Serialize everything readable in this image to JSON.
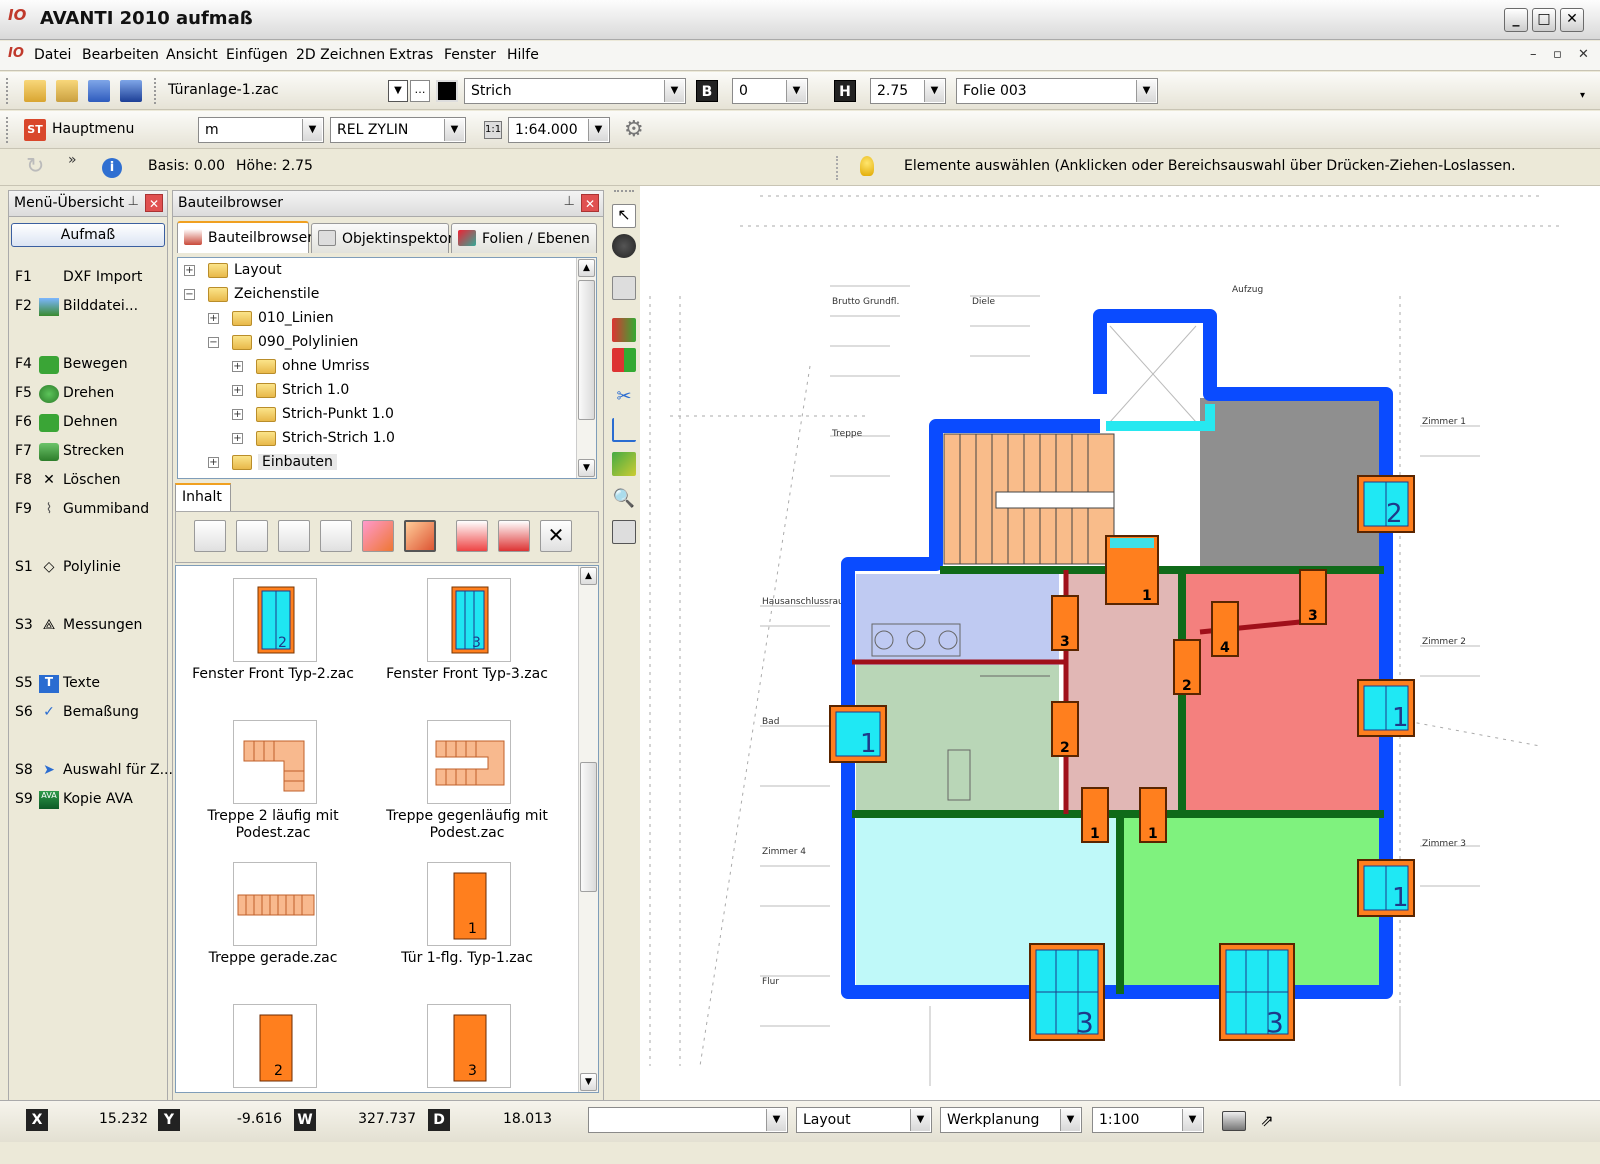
{
  "app": {
    "logo": "IO",
    "title": "AVANTI 2010 aufmaß",
    "window_buttons": [
      "_",
      "□",
      "✕"
    ],
    "mdi_buttons": [
      "–",
      "▫",
      "✕"
    ]
  },
  "menu": [
    "Datei",
    "Bearbeiten",
    "Ansicht",
    "Einfügen",
    "2D Zeichnen",
    "Extras",
    "Fenster",
    "Hilfe"
  ],
  "toolbar1": {
    "file_combo": "Türanlage-1.zac",
    "line_combo": "Strich",
    "b_label": "B",
    "b_value": "0",
    "h_label": "H",
    "h_value": "2.75",
    "layer_combo": "Folie 003"
  },
  "toolbar2": {
    "st_label": "ST",
    "mainmenu": "Hauptmenu",
    "unit": "m",
    "mode": "REL ZYLIN",
    "scale": "1:64.000"
  },
  "statusline": {
    "basis": "Basis: 0.00",
    "hoehe": "Höhe: 2.75",
    "hint": "Elemente auswählen (Anklicken oder Bereichsauswahl über Drücken-Ziehen-Loslassen."
  },
  "left_panel": {
    "title": "Menü-Übersicht",
    "button": "Aufmaß",
    "items": [
      {
        "key": "F1",
        "label": "DXF Import",
        "icon": "none"
      },
      {
        "key": "F2",
        "label": "Bilddatei...",
        "icon": "image-icon"
      },
      {
        "key": "F4",
        "label": "Bewegen",
        "icon": "move-icon"
      },
      {
        "key": "F5",
        "label": "Drehen",
        "icon": "rotate-icon"
      },
      {
        "key": "F6",
        "label": "Dehnen",
        "icon": "stretch-icon"
      },
      {
        "key": "F7",
        "label": "Strecken",
        "icon": "extend-icon"
      },
      {
        "key": "F8",
        "label": "Löschen",
        "icon": "delete-icon"
      },
      {
        "key": "F9",
        "label": "Gummiband",
        "icon": "rubberband-icon"
      },
      {
        "key": "S1",
        "label": "Polylinie",
        "icon": "polyline-icon"
      },
      {
        "key": "S3",
        "label": "Messungen",
        "icon": "measure-icon"
      },
      {
        "key": "S5",
        "label": "Texte",
        "icon": "text-icon"
      },
      {
        "key": "S6",
        "label": "Bemaßung",
        "icon": "dimension-icon"
      },
      {
        "key": "S8",
        "label": "Auswahl für Z...",
        "icon": "select-icon"
      },
      {
        "key": "S9",
        "label": "Kopie AVA",
        "icon": "ava-icon"
      }
    ]
  },
  "browser": {
    "title": "Bauteilbrowser",
    "tabs": [
      "Bauteilbrowser",
      "Objektinspektor",
      "Folien / Ebenen"
    ],
    "tree": [
      "Layout",
      "Zeichenstile",
      "010_Linien",
      "090_Polylinien",
      "ohne Umriss",
      "Strich 1.0",
      "Strich-Punkt 1.0",
      "Strich-Strich 1.0",
      "Einbauten"
    ],
    "content_tab": "Inhalt",
    "items": [
      {
        "caption": "Fenster Front Typ-2.zac",
        "num": "2"
      },
      {
        "caption": "Fenster Front Typ-3.zac",
        "num": "3"
      },
      {
        "caption": "Treppe 2 läufig mit Podest.zac"
      },
      {
        "caption": "Treppe gegenläufig mit Podest.zac"
      },
      {
        "caption": "Treppe gerade.zac"
      },
      {
        "caption": "Tür 1-flg. Typ-1.zac",
        "num": "1"
      },
      {
        "caption": "",
        "num": "2"
      },
      {
        "caption": "",
        "num": "3"
      }
    ]
  },
  "plan_labels": {
    "room1": "Brutto Grundfl.",
    "room2": "Diele",
    "room3": "Aufzug",
    "room4": "Treppe",
    "room5": "Zimmer 1",
    "room6": "Hausanschlussraum",
    "room7": "Zimmer 2",
    "room8": "Bad",
    "room9": "Zimmer 4",
    "room10": "Zimmer 3",
    "room11": "Flur",
    "win_left": "1",
    "win_right_top": "2",
    "win_right_mid": "1",
    "win_right_low": "1",
    "win_bottom_left": "3",
    "win_bottom_right": "3",
    "door_top": "1",
    "door_3a": "3",
    "door_3b": "3",
    "door_4": "4",
    "door_2a": "2",
    "door_2b": "2",
    "door_1a": "1",
    "door_1b": "1"
  },
  "bottom": {
    "x_label": "X",
    "x": "15.232",
    "y_label": "Y",
    "y": "-9.616",
    "w_label": "W",
    "w": "327.737",
    "d_label": "D",
    "d": "18.013",
    "combo_empty": "",
    "layout": "Layout",
    "werkplanung": "Werkplanung",
    "massstab": "1:100"
  }
}
